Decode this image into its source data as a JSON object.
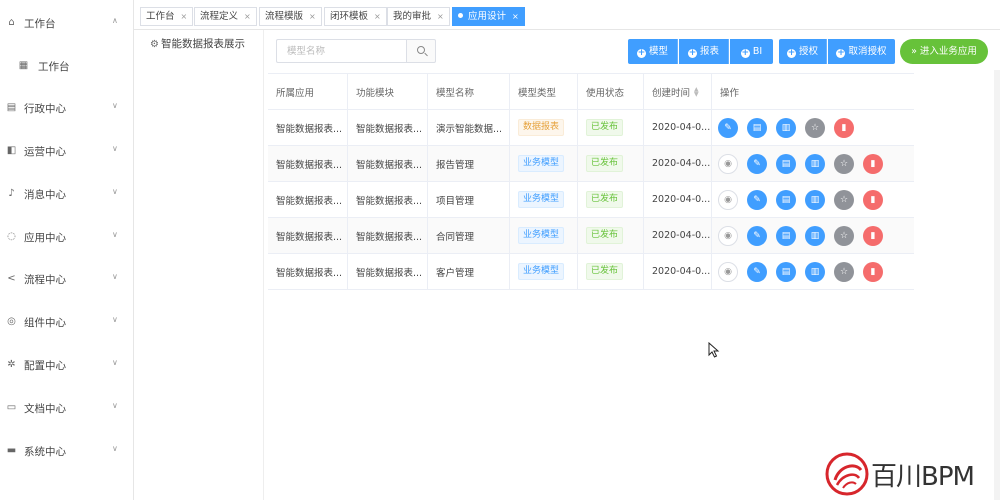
{
  "sidebar": {
    "items": [
      {
        "label": "工作台",
        "icon": "home-icon",
        "glyph": "⌂",
        "chevron": "∧"
      },
      {
        "label": "工作台",
        "icon": "grid-icon",
        "glyph": "▦",
        "chevron": ""
      },
      {
        "label": "行政中心",
        "icon": "building-icon",
        "glyph": "▤",
        "chevron": "∨"
      },
      {
        "label": "运营中心",
        "icon": "chart-icon",
        "glyph": "◧",
        "chevron": "∨"
      },
      {
        "label": "消息中心",
        "icon": "bell-icon",
        "glyph": "♪",
        "chevron": "∨"
      },
      {
        "label": "应用中心",
        "icon": "app-icon",
        "glyph": "◌",
        "chevron": "∨"
      },
      {
        "label": "流程中心",
        "icon": "share-icon",
        "glyph": "<",
        "chevron": "∨"
      },
      {
        "label": "组件中心",
        "icon": "component-icon",
        "glyph": "◎",
        "chevron": "∨"
      },
      {
        "label": "配置中心",
        "icon": "gear-icon",
        "glyph": "✲",
        "chevron": "∨"
      },
      {
        "label": "文档中心",
        "icon": "folder-icon",
        "glyph": "▭",
        "chevron": "∨"
      },
      {
        "label": "系统中心",
        "icon": "monitor-icon",
        "glyph": "▬",
        "chevron": "∨"
      }
    ]
  },
  "tabs": [
    {
      "label": "工作台"
    },
    {
      "label": "流程定义"
    },
    {
      "label": "流程模版"
    },
    {
      "label": "闭环模板"
    },
    {
      "label": "我的审批"
    },
    {
      "label": "应用设计"
    }
  ],
  "tree": {
    "root_label": "智能数据报表展示"
  },
  "toolbar": {
    "search_placeholder": "模型名称",
    "buttons": {
      "model": "模型",
      "report": "报表",
      "bi": "BI",
      "grant": "授权",
      "revoke": "取消授权",
      "enter": "进入业务应用"
    }
  },
  "table": {
    "headers": [
      "所属应用",
      "功能模块",
      "模型名称",
      "模型类型",
      "使用状态",
      "创建时间",
      "操作"
    ],
    "rows": [
      {
        "app": "智能数据报表...",
        "module": "智能数据报表...",
        "name": "演示智能数据...",
        "type": "数据报表",
        "type_color": "orange",
        "status": "已发布",
        "created": "2020-04-0...",
        "has_view": false
      },
      {
        "app": "智能数据报表...",
        "module": "智能数据报表...",
        "name": "报告管理",
        "type": "业务模型",
        "type_color": "blue",
        "status": "已发布",
        "created": "2020-04-0...",
        "has_view": true
      },
      {
        "app": "智能数据报表...",
        "module": "智能数据报表...",
        "name": "项目管理",
        "type": "业务模型",
        "type_color": "blue",
        "status": "已发布",
        "created": "2020-04-0...",
        "has_view": true
      },
      {
        "app": "智能数据报表...",
        "module": "智能数据报表...",
        "name": "合同管理",
        "type": "业务模型",
        "type_color": "blue",
        "status": "已发布",
        "created": "2020-04-0...",
        "has_view": true
      },
      {
        "app": "智能数据报表...",
        "module": "智能数据报表...",
        "name": "客户管理",
        "type": "业务模型",
        "type_color": "blue",
        "status": "已发布",
        "created": "2020-04-0...",
        "has_view": true
      }
    ]
  },
  "logo": {
    "text_cn": "百川",
    "text_en": "BPM"
  },
  "colors": {
    "primary": "#409eff",
    "success": "#67c23a",
    "danger": "#f56c6c",
    "gray": "#909399",
    "warning": "#e6a23c"
  }
}
